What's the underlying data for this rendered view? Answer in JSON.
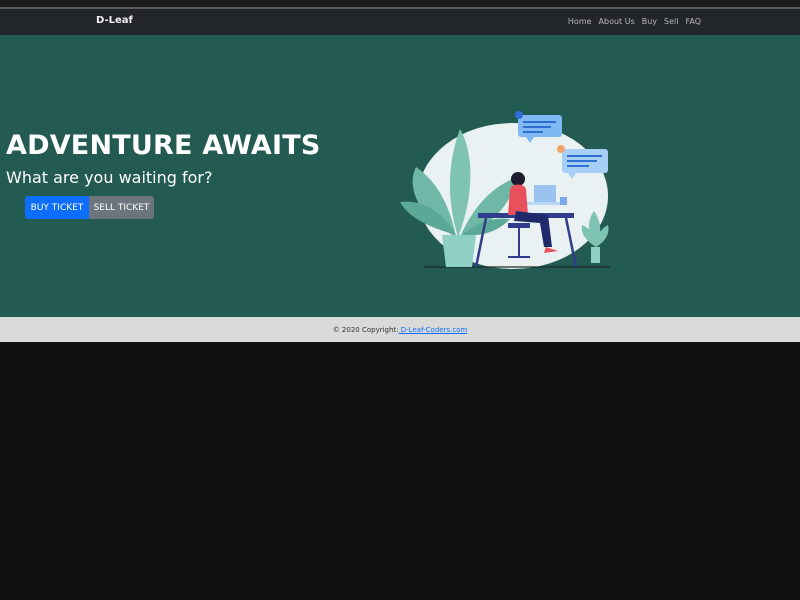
{
  "navbar": {
    "brand": "D-Leaf",
    "links": [
      "Home",
      "About Us",
      "Buy",
      "Sell",
      "FAQ"
    ]
  },
  "hero": {
    "title": "ADVENTURE AWAITS",
    "subtitle": "What are you waiting for?",
    "buy_button": "BUY TICKET",
    "sell_button": "SELL TICKET"
  },
  "footer": {
    "text": "© 2020 Copyright:",
    "link_text": " D-Leaf-Coders.com"
  },
  "colors": {
    "navbar_bg": "#222529",
    "hero_bg": "#235a51",
    "primary": "#0d6efd",
    "secondary": "#6c757d",
    "footer_bg": "#dadada",
    "page_bg": "#111111"
  }
}
